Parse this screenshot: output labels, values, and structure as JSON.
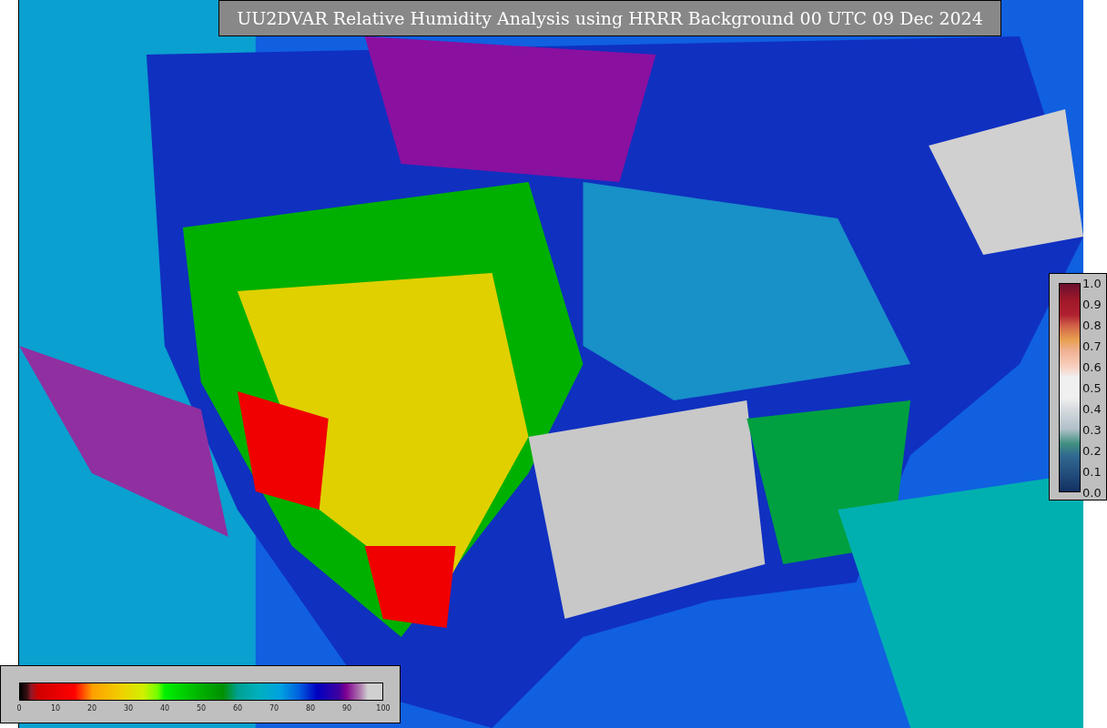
{
  "title": "UU2DVAR Relative Humidity Analysis using HRRR Background 00 UTC 09 Dec 2024",
  "humidity_colorbar": {
    "ticks": [
      "0",
      "10",
      "20",
      "30",
      "40",
      "50",
      "60",
      "70",
      "80",
      "90",
      "100"
    ]
  },
  "station_colorbar": {
    "ticks": [
      "1.0",
      "0.9",
      "0.8",
      "0.7",
      "0.6",
      "0.5",
      "0.4",
      "0.3",
      "0.2",
      "0.1",
      "0.0"
    ]
  }
}
